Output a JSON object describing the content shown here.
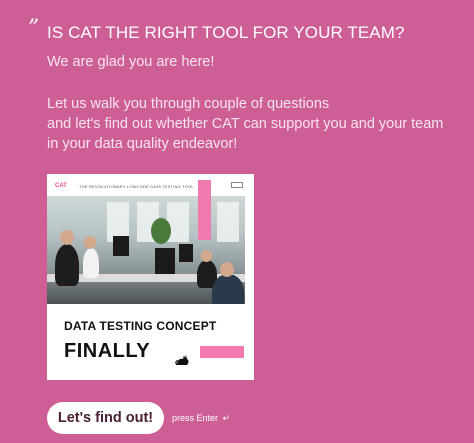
{
  "question": {
    "quote_mark": "”",
    "title": "IS CAT THE RIGHT TOOL FOR YOUR TEAM?",
    "subtitle": "We are glad you are here!",
    "intro_lines": [
      "Let us walk you through couple of questions",
      "and let's find out whether CAT can support you and your team",
      "in your data quality endeavor!"
    ]
  },
  "promo": {
    "brand": "CAT",
    "tagline": "THE REVOLUTIONARY LOWCODE DATA TESTING TOOL",
    "headline_1": "DATA TESTING CONCEPT",
    "headline_2": "FINALLY",
    "cat_icon": "cat-silhouette-icon"
  },
  "cta": {
    "button_label": "Let's find out!",
    "hint": "press Enter",
    "enter_icon": "↵"
  },
  "colors": {
    "background": "#cd5f96",
    "accent_pink": "#f07ab0",
    "button_bg": "#ffffff"
  }
}
